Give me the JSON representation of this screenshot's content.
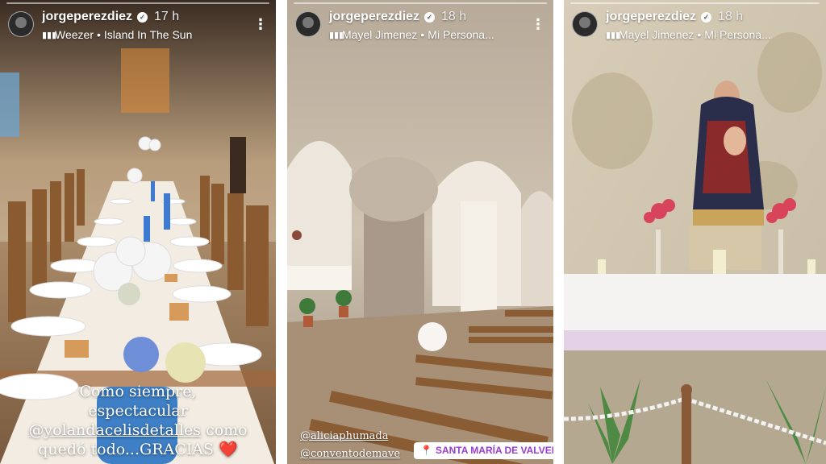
{
  "stories": [
    {
      "username": "jorgeperezdiez",
      "time": "17 h",
      "music_artist": "Weezer",
      "music_title": "Island In The Sun",
      "caption_line1": "Como siempre,",
      "caption_line2": "espectacular",
      "caption_mention": "@yolandacelisdetalles",
      "caption_after_mention": "como",
      "caption_line4": "quedó todo...GRACIAS",
      "heart": "❤️"
    },
    {
      "username": "jorgeperezdiez",
      "time": "18 h",
      "music_artist": "Mayel Jimenez",
      "music_title": "Mi Persona...",
      "tag1": "@aliciaphumada",
      "tag2": "@conventodemave",
      "location": "SANTA MARÍA DE VALVERDE"
    },
    {
      "username": "jorgeperezdiez",
      "time": "18 h",
      "music_artist": "Mayel Jimenez",
      "music_title": "Mi Persona..."
    }
  ],
  "icons": {
    "verified": "verified-badge-icon",
    "music": "music-bars-icon",
    "more": "more-options-icon",
    "location": "location-pin-icon"
  },
  "colors": {
    "location_text": "#9b3bd1",
    "heart": "#ff3b3b"
  }
}
